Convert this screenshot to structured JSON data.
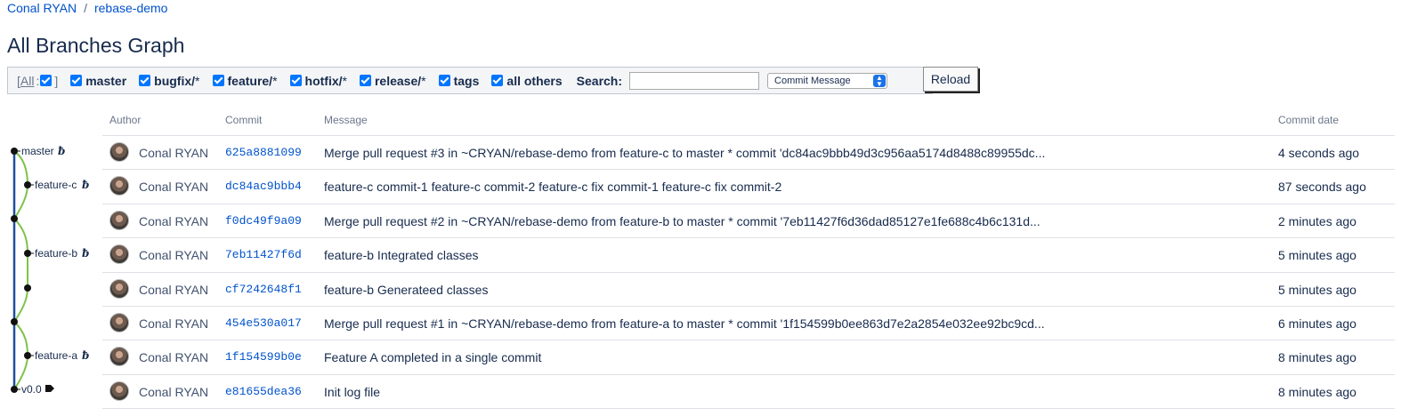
{
  "breadcrumb": {
    "project": "Conal RYAN",
    "separator": "/",
    "repo": "rebase-demo"
  },
  "page_title": "All Branches Graph",
  "filters": {
    "all_open": "[",
    "all_label": "All",
    "all_colon": ":",
    "all_close": "]",
    "items": [
      {
        "label": "master",
        "suffix": ""
      },
      {
        "label": "bugfix/",
        "suffix": "*"
      },
      {
        "label": "feature/",
        "suffix": "*"
      },
      {
        "label": "hotfix/",
        "suffix": "*"
      },
      {
        "label": "release/",
        "suffix": "*"
      },
      {
        "label": "tags",
        "suffix": ""
      },
      {
        "label": "all others",
        "suffix": ""
      }
    ],
    "search_label": "Search:",
    "search_value": "",
    "search_mode": "Commit Message",
    "reload_label": "Reload"
  },
  "columns": {
    "author": "Author",
    "commit": "Commit",
    "message": "Message",
    "date": "Commit date"
  },
  "graph": {
    "labels": [
      {
        "text": "master",
        "type": "branch"
      },
      {
        "text": "feature-c",
        "type": "branch"
      },
      {
        "text": "feature-b",
        "type": "branch"
      },
      {
        "text": "feature-a",
        "type": "branch"
      },
      {
        "text": "v0.0",
        "type": "tag"
      }
    ],
    "colors": {
      "master": "#1f4e9e",
      "feature": "#7ec24a"
    }
  },
  "commits": [
    {
      "author": "Conal RYAN",
      "hash": "625a8881099",
      "message": "Merge pull request #3 in ~CRYAN/rebase-demo from feature-c to master * commit 'dc84ac9bbb49d3c956aa5174d8488c89955dc...",
      "date": "4 seconds ago"
    },
    {
      "author": "Conal RYAN",
      "hash": "dc84ac9bbb4",
      "message": "feature-c commit-1 feature-c commit-2 feature-c fix commit-1 feature-c fix commit-2",
      "date": "87 seconds ago"
    },
    {
      "author": "Conal RYAN",
      "hash": "f0dc49f9a09",
      "message": "Merge pull request #2 in ~CRYAN/rebase-demo from feature-b to master * commit '7eb11427f6d36dad85127e1fe688c4b6c131d...",
      "date": "2 minutes ago"
    },
    {
      "author": "Conal RYAN",
      "hash": "7eb11427f6d",
      "message": "feature-b Integrated classes",
      "date": "5 minutes ago"
    },
    {
      "author": "Conal RYAN",
      "hash": "cf7242648f1",
      "message": "feature-b Generateed classes",
      "date": "5 minutes ago"
    },
    {
      "author": "Conal RYAN",
      "hash": "454e530a017",
      "message": "Merge pull request #1 in ~CRYAN/rebase-demo from feature-a to master * commit '1f154599b0ee863d7e2a2854e032ee92bc9cd...",
      "date": "6 minutes ago"
    },
    {
      "author": "Conal RYAN",
      "hash": "1f154599b0e",
      "message": "Feature A completed in a single commit",
      "date": "8 minutes ago"
    },
    {
      "author": "Conal RYAN",
      "hash": "e81655dea36",
      "message": "Init log file",
      "date": "8 minutes ago"
    }
  ]
}
